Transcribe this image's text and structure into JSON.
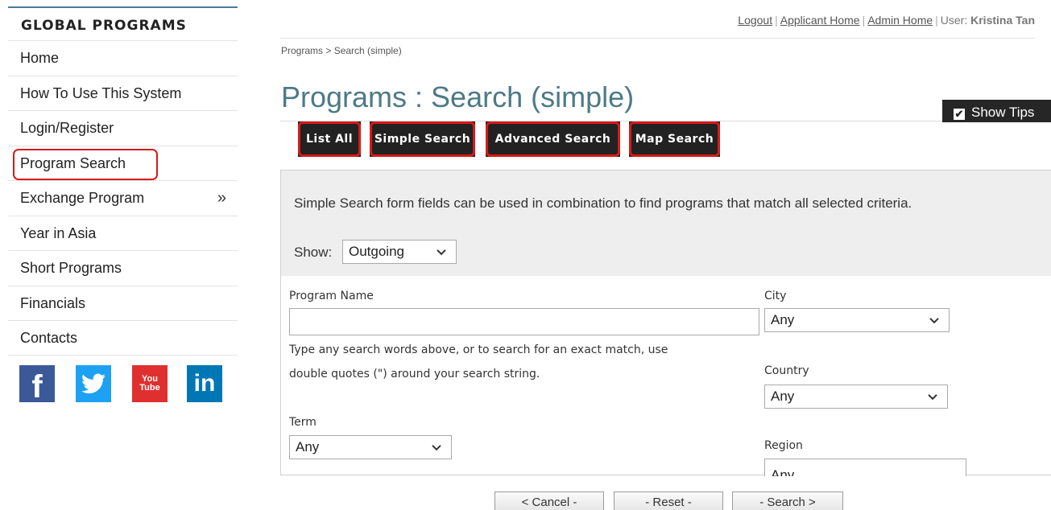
{
  "sidebar": {
    "heading": "GLOBAL PROGRAMS",
    "items": [
      {
        "label": "Home"
      },
      {
        "label": "How To Use This System"
      },
      {
        "label": "Login/Register"
      },
      {
        "label": "Program Search",
        "active": true
      },
      {
        "label": "Exchange Program",
        "chevron": "»"
      },
      {
        "label": "Year in Asia"
      },
      {
        "label": "Short Programs"
      },
      {
        "label": "Financials"
      },
      {
        "label": "Contacts"
      }
    ],
    "social": {
      "facebook": "f",
      "youtube_line1": "You",
      "youtube_line2": "Tube",
      "linkedin": "in"
    }
  },
  "topbar": {
    "logout": "Logout",
    "applicant_home": "Applicant Home",
    "admin_home": "Admin Home",
    "separator": "|",
    "user_label": "User:",
    "user_name": "Kristina Tan"
  },
  "breadcrumb": "Programs > Search (simple)",
  "page_title": "Programs : Search (simple)",
  "show_tips": {
    "label": "Show Tips",
    "checked": true,
    "check_glyph": "✔"
  },
  "tabs": {
    "list_all": "List All",
    "simple_search": "Simple Search",
    "advanced_search": "Advanced Search",
    "map_search": "Map Search"
  },
  "form": {
    "intro": "Simple Search form fields can be used in combination to find programs that match all selected criteria.",
    "show_label": "Show:",
    "show_value": "Outgoing",
    "program_name_label": "Program Name",
    "program_name_value": "",
    "help_line1": "Type any search words above, or to search for an exact match, use",
    "help_line2": "double quotes (\") around your search string.",
    "city_label": "City",
    "city_value": "Any",
    "country_label": "Country",
    "country_value": "Any",
    "term_label": "Term",
    "term_value": "Any",
    "region_label": "Region",
    "region_value": "Any"
  },
  "buttons": {
    "cancel": "< Cancel -",
    "reset": "- Reset -",
    "search": "- Search >"
  },
  "colors": {
    "accent_title": "#4d7a86",
    "highlight_red": "#d71a1a",
    "tab_bg": "#222222"
  }
}
